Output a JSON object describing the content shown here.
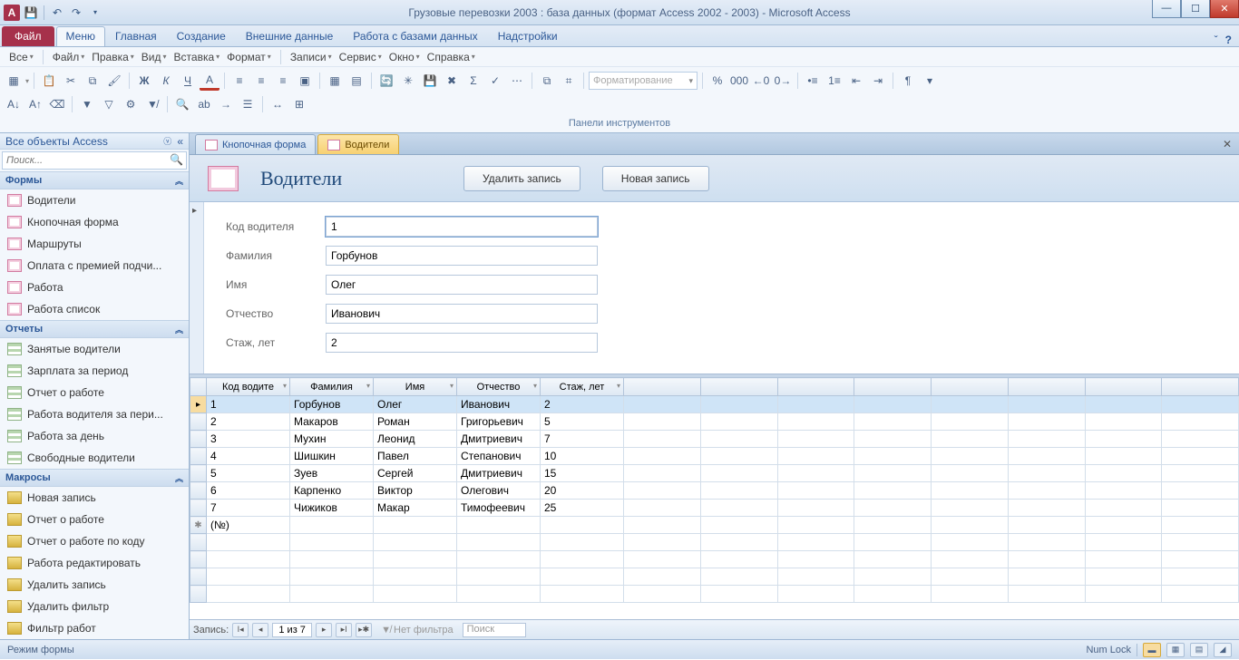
{
  "titlebar": {
    "app_letter": "A",
    "title": "Грузовые перевозки 2003 : база данных (формат Access 2002 - 2003)  -  Microsoft Access"
  },
  "ribbon": {
    "file": "Файл",
    "tabs": [
      "Меню",
      "Главная",
      "Создание",
      "Внешние данные",
      "Работа с базами данных",
      "Надстройки"
    ],
    "active": 0
  },
  "legacy_menu": [
    "Все",
    "Файл",
    "Правка",
    "Вид",
    "Вставка",
    "Формат",
    "Записи",
    "Сервис",
    "Окно",
    "Справка"
  ],
  "toolbar": {
    "formatting_placeholder": "Форматирование",
    "group_label": "Панели инструментов"
  },
  "nav": {
    "header": "Все объекты Access",
    "search_placeholder": "Поиск...",
    "groups": [
      {
        "title": "Формы",
        "type": "form",
        "items": [
          "Водители",
          "Кнопочная форма",
          "Маршруты",
          "Оплата с премией подчи...",
          "Работа",
          "Работа список"
        ]
      },
      {
        "title": "Отчеты",
        "type": "report",
        "items": [
          "Занятые водители",
          "Зарплата за период",
          "Отчет о работе",
          "Работа водителя за пери...",
          "Работа за день",
          "Свободные водители"
        ]
      },
      {
        "title": "Макросы",
        "type": "macro",
        "items": [
          "Новая запись",
          "Отчет о работе",
          "Отчет о работе по коду",
          "Работа редактировать",
          "Удалить запись",
          "Удалить фильтр",
          "Фильтр работ"
        ]
      }
    ]
  },
  "content_tabs": {
    "tabs": [
      "Кнопочная форма",
      "Водители"
    ],
    "active": 1
  },
  "form": {
    "title": "Водители",
    "btn_delete": "Удалить запись",
    "btn_new": "Новая запись",
    "fields": [
      {
        "label": "Код водителя",
        "value": "1"
      },
      {
        "label": "Фамилия",
        "value": "Горбунов"
      },
      {
        "label": "Имя",
        "value": "Олег"
      },
      {
        "label": "Отчество",
        "value": "Иванович"
      },
      {
        "label": "Стаж, лет",
        "value": "2"
      }
    ]
  },
  "datasheet": {
    "columns": [
      "Код водите",
      "Фамилия",
      "Имя",
      "Отчество",
      "Стаж, лет"
    ],
    "rows": [
      [
        "1",
        "Горбунов",
        "Олег",
        "Иванович",
        "2"
      ],
      [
        "2",
        "Макаров",
        "Роман",
        "Григорьевич",
        "5"
      ],
      [
        "3",
        "Мухин",
        "Леонид",
        "Дмитриевич",
        "7"
      ],
      [
        "4",
        "Шишкин",
        "Павел",
        "Степанович",
        "10"
      ],
      [
        "5",
        "Зуев",
        "Сергей",
        "Дмитриевич",
        "15"
      ],
      [
        "6",
        "Карпенко",
        "Виктор",
        "Олегович",
        "20"
      ],
      [
        "7",
        "Чижиков",
        "Макар",
        "Тимофеевич",
        "25"
      ]
    ],
    "new_row_label": "(№)"
  },
  "recnav": {
    "label": "Запись:",
    "pos": "1 из 7",
    "no_filter": "Нет фильтра",
    "search": "Поиск"
  },
  "status": {
    "left": "Режим формы",
    "numlock": "Num Lock"
  }
}
